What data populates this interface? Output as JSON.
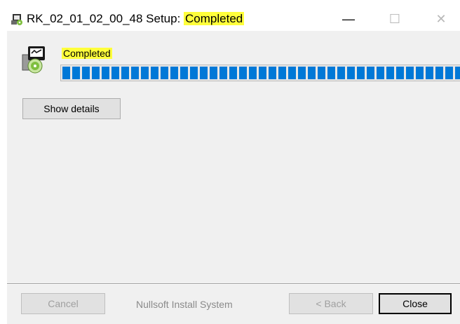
{
  "window": {
    "title_prefix": "RK_02_01_02_00_48 Setup: ",
    "title_status": "Completed",
    "controls": [
      {
        "name": "minimize",
        "glyph": "—",
        "enabled": true
      },
      {
        "name": "maximize",
        "glyph": "☐",
        "enabled": false
      },
      {
        "name": "close",
        "glyph": "✕",
        "enabled": false
      }
    ]
  },
  "status": {
    "text": "Completed",
    "progress_fraction": 1.0
  },
  "details_button": {
    "label": "Show details"
  },
  "footer": {
    "cancel_label": "Cancel",
    "branding": "Nullsoft Install System",
    "back_label": "< Back",
    "close_label": "Close"
  },
  "colors": {
    "highlight": "#ffff3b",
    "progress": "#0078d7",
    "dialog_bg": "#f0f0f0"
  },
  "icons": {
    "app": "installer-app-icon",
    "installer": "installer-disc-icon"
  }
}
